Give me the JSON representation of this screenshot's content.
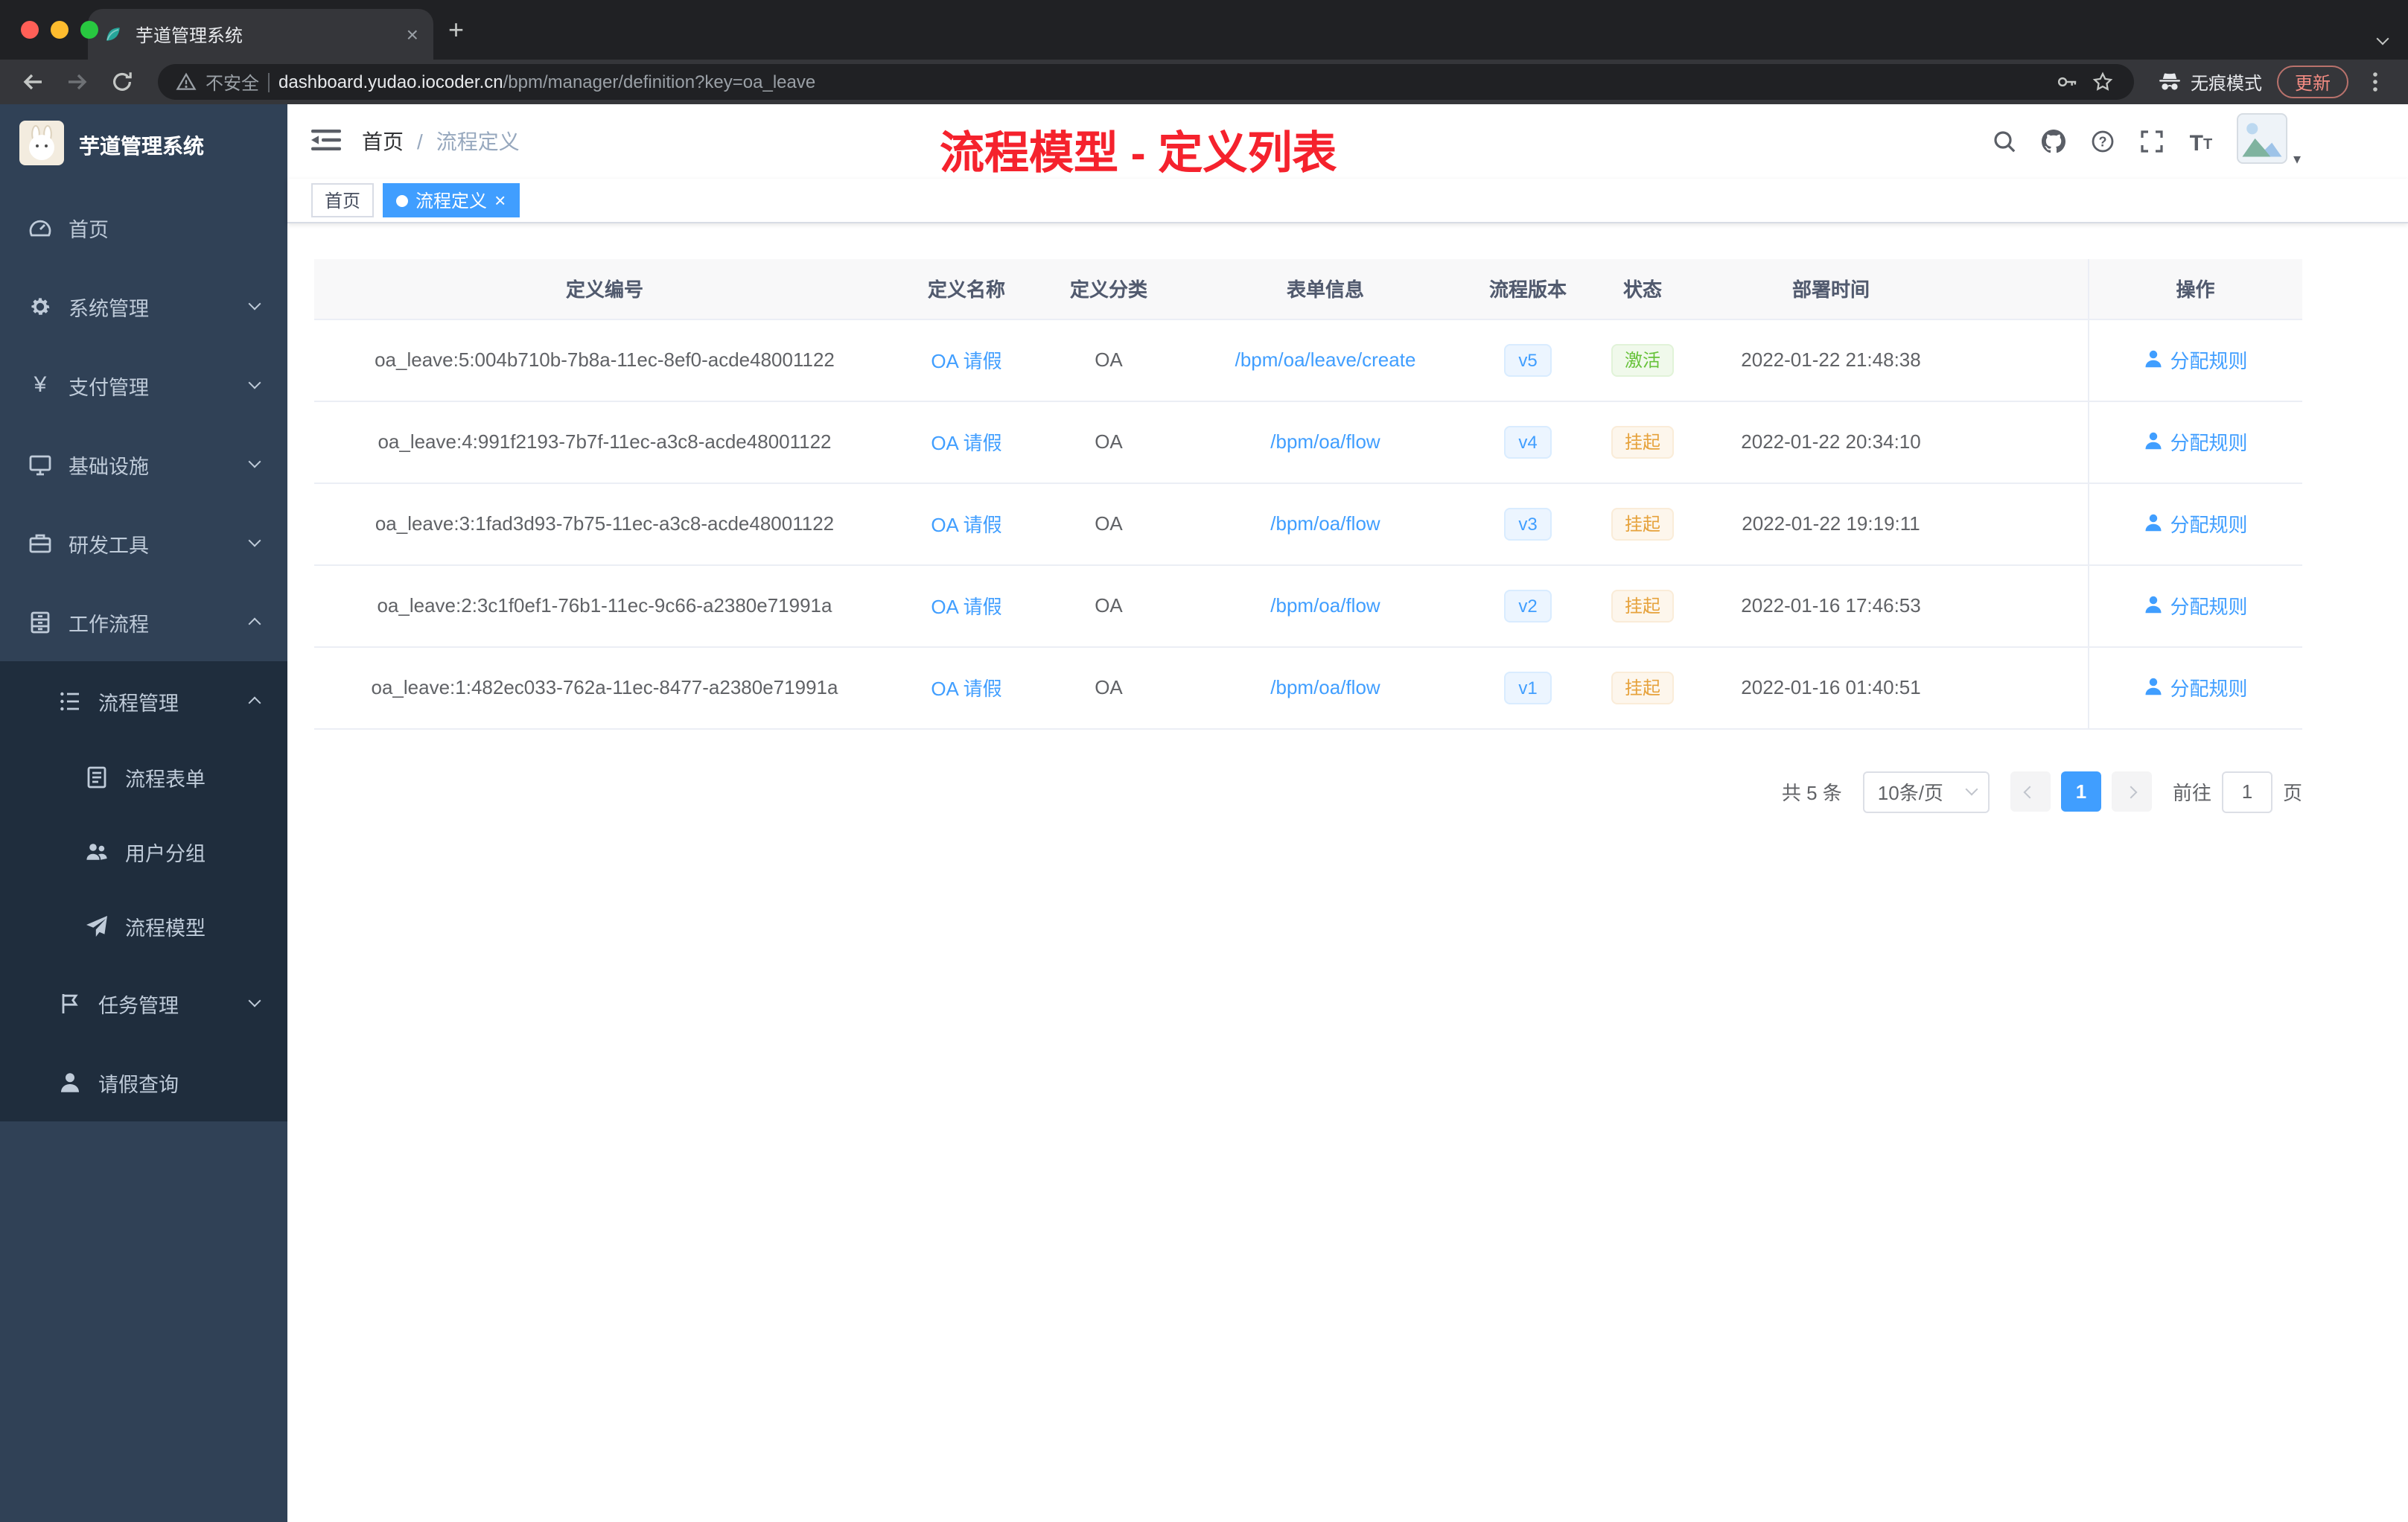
{
  "browser": {
    "tab_title": "芋道管理系统",
    "new_tab_button": "+",
    "security_label": "不安全",
    "url_domain": "dashboard.yudao.iocoder.cn",
    "url_path": "/bpm/manager/definition?key=oa_leave",
    "incognito_label": "无痕模式",
    "update_button": "更新"
  },
  "sidebar": {
    "app_title": "芋道管理系统",
    "menu": [
      {
        "label": "首页"
      },
      {
        "label": "系统管理"
      },
      {
        "label": "支付管理"
      },
      {
        "label": "基础设施"
      },
      {
        "label": "研发工具"
      },
      {
        "label": "工作流程"
      },
      {
        "label": "流程管理"
      },
      {
        "label": "流程表单"
      },
      {
        "label": "用户分组"
      },
      {
        "label": "流程模型"
      },
      {
        "label": "任务管理"
      },
      {
        "label": "请假查询"
      }
    ]
  },
  "header": {
    "breadcrumb_home": "首页",
    "breadcrumb_separator": "/",
    "breadcrumb_current": "流程定义",
    "annotation": "流程模型 - 定义列表"
  },
  "tags": [
    {
      "label": "首页"
    },
    {
      "label": "流程定义"
    }
  ],
  "table": {
    "columns": [
      "定义编号",
      "定义名称",
      "定义分类",
      "表单信息",
      "流程版本",
      "状态",
      "部署时间",
      "操作"
    ],
    "rows": [
      {
        "id": "oa_leave:5:004b710b-7b8a-11ec-8ef0-acde48001122",
        "name": "OA 请假",
        "category": "OA",
        "form": "/bpm/oa/leave/create",
        "version": "v5",
        "status": "激活",
        "status_type": "success",
        "time": "2022-01-22 21:48:38",
        "action": "分配规则"
      },
      {
        "id": "oa_leave:4:991f2193-7b7f-11ec-a3c8-acde48001122",
        "name": "OA 请假",
        "category": "OA",
        "form": "/bpm/oa/flow",
        "version": "v4",
        "status": "挂起",
        "status_type": "warning",
        "time": "2022-01-22 20:34:10",
        "action": "分配规则"
      },
      {
        "id": "oa_leave:3:1fad3d93-7b75-11ec-a3c8-acde48001122",
        "name": "OA 请假",
        "category": "OA",
        "form": "/bpm/oa/flow",
        "version": "v3",
        "status": "挂起",
        "status_type": "warning",
        "time": "2022-01-22 19:19:11",
        "action": "分配规则"
      },
      {
        "id": "oa_leave:2:3c1f0ef1-76b1-11ec-9c66-a2380e71991a",
        "name": "OA 请假",
        "category": "OA",
        "form": "/bpm/oa/flow",
        "version": "v2",
        "status": "挂起",
        "status_type": "warning",
        "time": "2022-01-16 17:46:53",
        "action": "分配规则"
      },
      {
        "id": "oa_leave:1:482ec033-762a-11ec-8477-a2380e71991a",
        "name": "OA 请假",
        "category": "OA",
        "form": "/bpm/oa/flow",
        "version": "v1",
        "status": "挂起",
        "status_type": "warning",
        "time": "2022-01-16 01:40:51",
        "action": "分配规则"
      }
    ]
  },
  "pagination": {
    "total": "共 5 条",
    "page_size": "10条/页",
    "page": "1",
    "goto": "前往",
    "goto_value": "1",
    "unit": "页"
  },
  "colors": {
    "primary": "#409eff",
    "success": "#67c23a",
    "warning": "#e6a23c",
    "annotation_red": "#f5222d",
    "sidebar_bg": "#304156",
    "submenu_bg": "#1f2d3d",
    "chrome_bg": "#202124"
  }
}
